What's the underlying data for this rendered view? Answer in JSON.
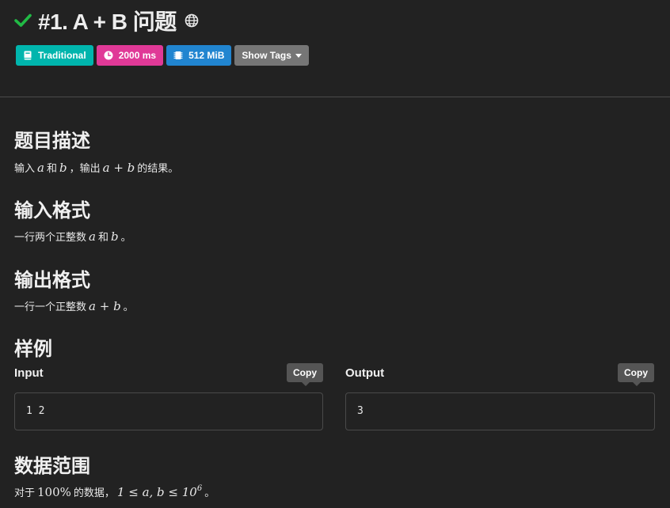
{
  "header": {
    "title": "#1. A + B 问题"
  },
  "tags": {
    "type": "Traditional",
    "time_limit": "2000 ms",
    "memory_limit": "512 MiB",
    "show_tags": "Show Tags"
  },
  "colors": {
    "accent_check": "#21ba45",
    "tag_teal": "#00b5ad",
    "tag_pink": "#e03997",
    "tag_blue": "#2185d0",
    "tag_grey": "#767676"
  },
  "description": {
    "heading": "题目描述",
    "text_1": "输入",
    "var_a": "a",
    "text_2": "和",
    "var_b": "b",
    "text_3": "，输出",
    "expr": "a + b",
    "text_4": "的结果。"
  },
  "input_format": {
    "heading": "输入格式",
    "text_1": "一行两个正整数",
    "var_a": "a",
    "text_2": "和",
    "var_b": "b",
    "text_3": "。"
  },
  "output_format": {
    "heading": "输出格式",
    "text_1": "一行一个正整数",
    "expr": "a + b",
    "text_2": "。"
  },
  "sample": {
    "heading": "样例",
    "input_label": "Input",
    "output_label": "Output",
    "copy_label": "Copy",
    "input_value": "1 2",
    "output_value": "3"
  },
  "constraints": {
    "heading": "数据范围",
    "text_1": "对于",
    "percent": "100%",
    "text_2": "的数据，",
    "expr_1": "1 ≤ a, b ≤ 10",
    "exponent": "6",
    "text_3": "。"
  }
}
